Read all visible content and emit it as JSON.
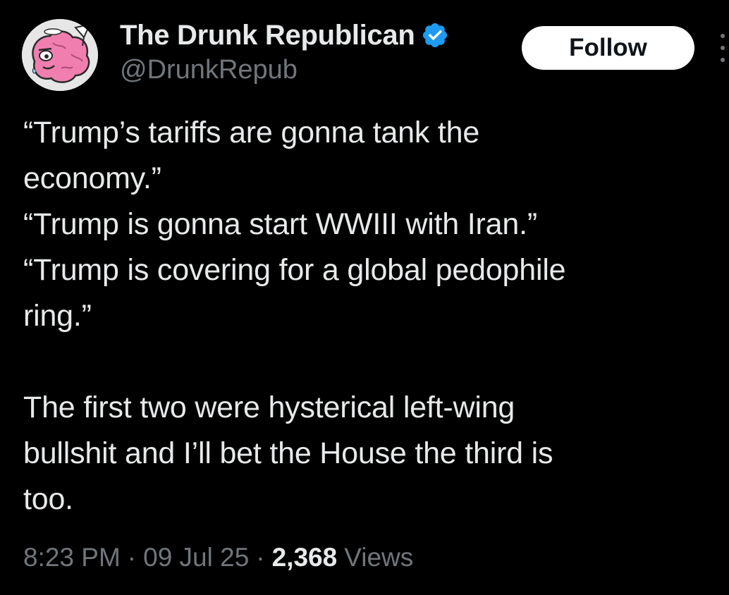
{
  "author": {
    "display_name": "The Drunk Republican",
    "handle": "@DrunkRepub",
    "verified": true,
    "avatar_icon": "pink-brain-mascot-icon"
  },
  "actions": {
    "follow_label": "Follow",
    "more_icon": "more-dots-icon"
  },
  "tweet": {
    "text": "“Trump’s tariffs are gonna tank the\neconomy.”\n“Trump is gonna start WWIII with Iran.”\n“Trump is covering for a global pedophile\nring.”\n\nThe first two were hysterical left-wing\nbullshit and I’ll bet the House the third is\ntoo."
  },
  "meta": {
    "time": "8:23 PM",
    "separator": "·",
    "date": "09 Jul 25",
    "views_count": "2,368",
    "views_label": "Views"
  },
  "colors": {
    "background": "#000000",
    "primary_text": "#e7e9ea",
    "secondary_text": "#71767b",
    "verified_blue": "#1d9bf0",
    "follow_bg": "#ffffff"
  }
}
